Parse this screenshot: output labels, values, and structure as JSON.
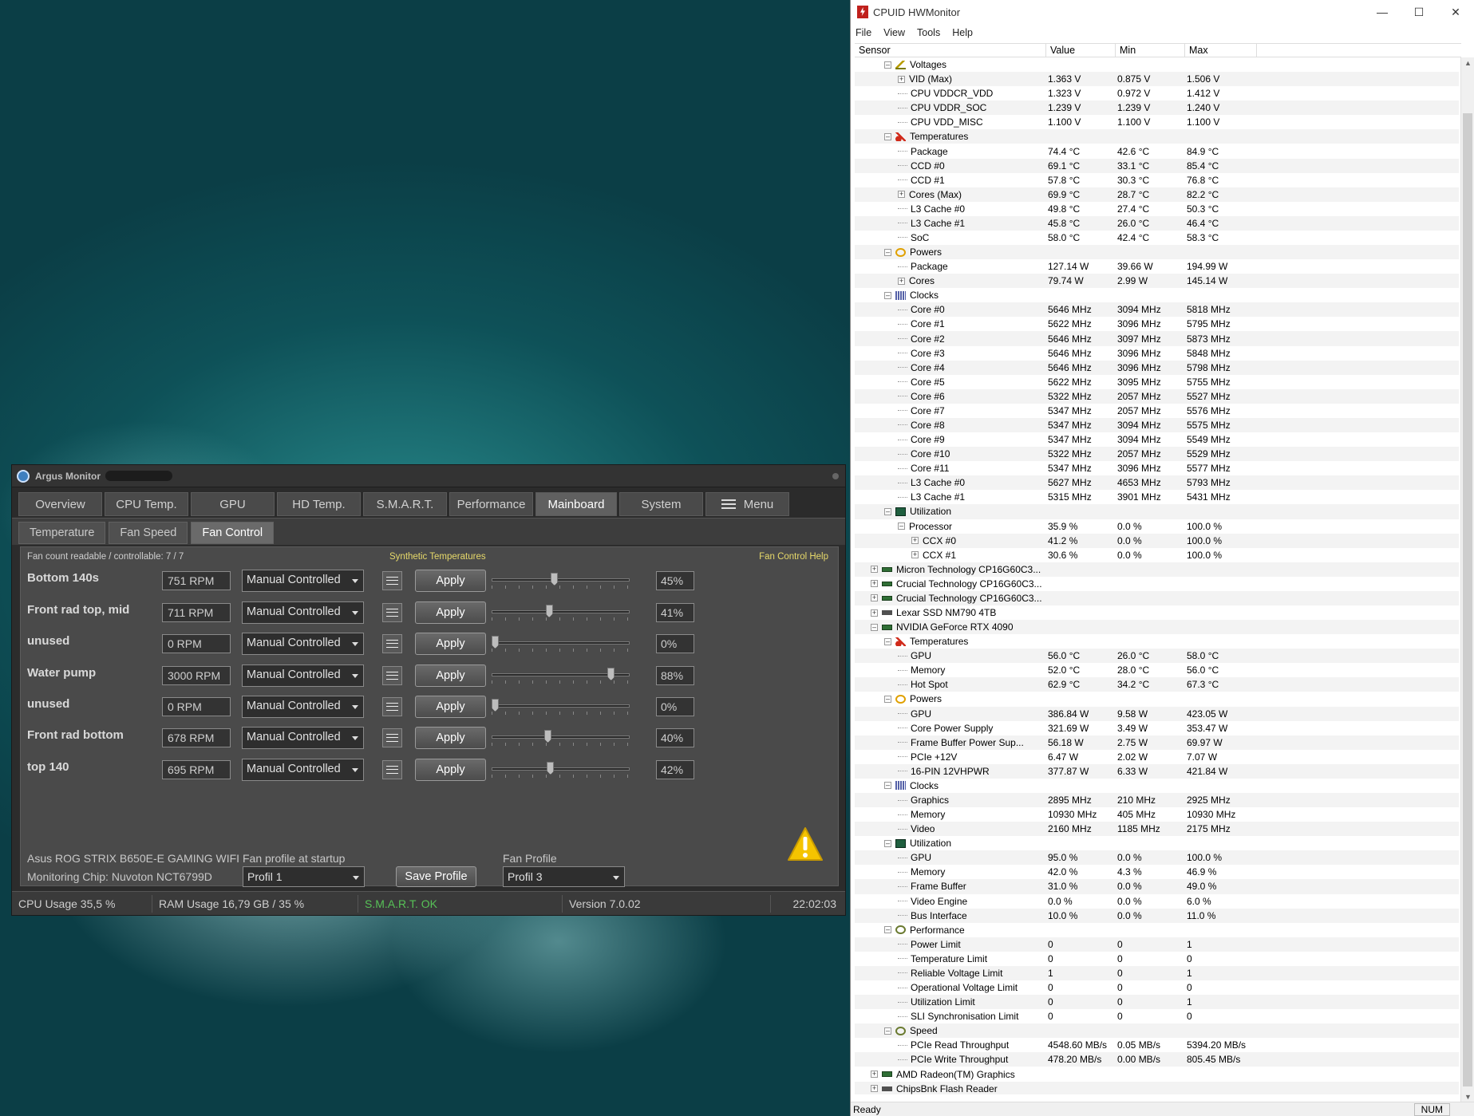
{
  "argus": {
    "title": "Argus Monitor",
    "tabs": [
      "Overview",
      "CPU Temp.",
      "GPU",
      "HD Temp.",
      "S.M.A.R.T.",
      "Performance",
      "Mainboard",
      "System"
    ],
    "menu_label": "Menu",
    "active_tab": "Mainboard",
    "subtabs": [
      "Temperature",
      "Fan Speed",
      "Fan Control"
    ],
    "active_subtab": "Fan Control",
    "fan_count_text": "Fan count readable / controllable: 7 / 7",
    "synthetic_link": "Synthetic Temperatures",
    "help_link": "Fan Control Help",
    "apply_label": "Apply",
    "fans": [
      {
        "name": "Bottom 140s",
        "rpm": "751 RPM",
        "mode": "Manual Controlled",
        "percent": 45,
        "percent_text": "45%"
      },
      {
        "name": "Front rad top, mid",
        "rpm": "711 RPM",
        "mode": "Manual Controlled",
        "percent": 41,
        "percent_text": "41%"
      },
      {
        "name": "unused",
        "rpm": "0 RPM",
        "mode": "Manual Controlled",
        "percent": 0,
        "percent_text": "0%"
      },
      {
        "name": "Water pump",
        "rpm": "3000 RPM",
        "mode": "Manual Controlled",
        "percent": 88,
        "percent_text": "88%"
      },
      {
        "name": "unused",
        "rpm": "0 RPM",
        "mode": "Manual Controlled",
        "percent": 0,
        "percent_text": "0%"
      },
      {
        "name": "Front rad bottom",
        "rpm": "678 RPM",
        "mode": "Manual Controlled",
        "percent": 40,
        "percent_text": "40%"
      },
      {
        "name": "top 140",
        "rpm": "695 RPM",
        "mode": "Manual Controlled",
        "percent": 42,
        "percent_text": "42%"
      }
    ],
    "board": "Asus ROG STRIX B650E-E GAMING WIFI",
    "chip": "Monitoring Chip: Nuvoton NCT6799D",
    "startup_label": "Fan profile at startup",
    "startup_value": "Profil 1",
    "save_label": "Save Profile",
    "profile_label": "Fan Profile",
    "profile_value": "Profil 3",
    "status": {
      "cpu": "CPU Usage 35,5 %",
      "ram": "RAM Usage 16,79 GB / 35 %",
      "smart": "S.M.A.R.T. OK",
      "version": "Version 7.0.02",
      "time": "22:02:03"
    },
    "colors": {
      "smart_ok": "#57c257",
      "link_yellow": "#e7d96a",
      "warn": "#f5c400"
    }
  },
  "hwm": {
    "title": "CPUID HWMonitor",
    "menu": [
      "File",
      "View",
      "Tools",
      "Help"
    ],
    "columns": [
      "Sensor",
      "Value",
      "Min",
      "Max"
    ],
    "rows": [
      {
        "d": 2,
        "t": "g",
        "icon": "volt",
        "exp": "-",
        "name": "Voltages"
      },
      {
        "d": 3,
        "exp": "+",
        "name": "VID (Max)",
        "v": "1.363 V",
        "mn": "0.875 V",
        "mx": "1.506 V"
      },
      {
        "d": 3,
        "name": "CPU VDDCR_VDD",
        "v": "1.323 V",
        "mn": "0.972 V",
        "mx": "1.412 V"
      },
      {
        "d": 3,
        "name": "CPU VDDR_SOC",
        "v": "1.239 V",
        "mn": "1.239 V",
        "mx": "1.240 V"
      },
      {
        "d": 3,
        "name": "CPU VDD_MISC",
        "v": "1.100 V",
        "mn": "1.100 V",
        "mx": "1.100 V"
      },
      {
        "d": 2,
        "t": "g",
        "icon": "temp",
        "exp": "-",
        "name": "Temperatures"
      },
      {
        "d": 3,
        "name": "Package",
        "v": "74.4 °C",
        "mn": "42.6 °C",
        "mx": "84.9 °C"
      },
      {
        "d": 3,
        "name": "CCD #0",
        "v": "69.1 °C",
        "mn": "33.1 °C",
        "mx": "85.4 °C"
      },
      {
        "d": 3,
        "name": "CCD #1",
        "v": "57.8 °C",
        "mn": "30.3 °C",
        "mx": "76.8 °C"
      },
      {
        "d": 3,
        "exp": "+",
        "name": "Cores (Max)",
        "v": "69.9 °C",
        "mn": "28.7 °C",
        "mx": "82.2 °C"
      },
      {
        "d": 3,
        "name": "L3 Cache #0",
        "v": "49.8 °C",
        "mn": "27.4 °C",
        "mx": "50.3 °C"
      },
      {
        "d": 3,
        "name": "L3 Cache #1",
        "v": "45.8 °C",
        "mn": "26.0 °C",
        "mx": "46.4 °C"
      },
      {
        "d": 3,
        "name": "SoC",
        "v": "58.0 °C",
        "mn": "42.4 °C",
        "mx": "58.3 °C"
      },
      {
        "d": 2,
        "t": "g",
        "icon": "pow",
        "exp": "-",
        "name": "Powers"
      },
      {
        "d": 3,
        "name": "Package",
        "v": "127.14 W",
        "mn": "39.66 W",
        "mx": "194.99 W"
      },
      {
        "d": 3,
        "exp": "+",
        "name": "Cores",
        "v": "79.74 W",
        "mn": "2.99 W",
        "mx": "145.14 W"
      },
      {
        "d": 2,
        "t": "g",
        "icon": "clk",
        "exp": "-",
        "name": "Clocks"
      },
      {
        "d": 3,
        "name": "Core #0",
        "v": "5646 MHz",
        "mn": "3094 MHz",
        "mx": "5818 MHz"
      },
      {
        "d": 3,
        "name": "Core #1",
        "v": "5622 MHz",
        "mn": "3096 MHz",
        "mx": "5795 MHz"
      },
      {
        "d": 3,
        "name": "Core #2",
        "v": "5646 MHz",
        "mn": "3097 MHz",
        "mx": "5873 MHz"
      },
      {
        "d": 3,
        "name": "Core #3",
        "v": "5646 MHz",
        "mn": "3096 MHz",
        "mx": "5848 MHz"
      },
      {
        "d": 3,
        "name": "Core #4",
        "v": "5646 MHz",
        "mn": "3096 MHz",
        "mx": "5798 MHz"
      },
      {
        "d": 3,
        "name": "Core #5",
        "v": "5622 MHz",
        "mn": "3095 MHz",
        "mx": "5755 MHz"
      },
      {
        "d": 3,
        "name": "Core #6",
        "v": "5322 MHz",
        "mn": "2057 MHz",
        "mx": "5527 MHz"
      },
      {
        "d": 3,
        "name": "Core #7",
        "v": "5347 MHz",
        "mn": "2057 MHz",
        "mx": "5576 MHz"
      },
      {
        "d": 3,
        "name": "Core #8",
        "v": "5347 MHz",
        "mn": "3094 MHz",
        "mx": "5575 MHz"
      },
      {
        "d": 3,
        "name": "Core #9",
        "v": "5347 MHz",
        "mn": "3094 MHz",
        "mx": "5549 MHz"
      },
      {
        "d": 3,
        "name": "Core #10",
        "v": "5322 MHz",
        "mn": "2057 MHz",
        "mx": "5529 MHz"
      },
      {
        "d": 3,
        "name": "Core #11",
        "v": "5347 MHz",
        "mn": "3096 MHz",
        "mx": "5577 MHz"
      },
      {
        "d": 3,
        "name": "L3 Cache #0",
        "v": "5627 MHz",
        "mn": "4653 MHz",
        "mx": "5793 MHz"
      },
      {
        "d": 3,
        "name": "L3 Cache #1",
        "v": "5315 MHz",
        "mn": "3901 MHz",
        "mx": "5431 MHz"
      },
      {
        "d": 2,
        "t": "g",
        "icon": "util",
        "exp": "-",
        "name": "Utilization"
      },
      {
        "d": 3,
        "exp": "-",
        "name": "Processor",
        "v": "35.9 %",
        "mn": "0.0 %",
        "mx": "100.0 %"
      },
      {
        "d": 4,
        "exp": "+",
        "name": "CCX #0",
        "v": "41.2 %",
        "mn": "0.0 %",
        "mx": "100.0 %"
      },
      {
        "d": 4,
        "exp": "+",
        "name": "CCX #1",
        "v": "30.6 %",
        "mn": "0.0 %",
        "mx": "100.0 %"
      },
      {
        "d": 1,
        "t": "g",
        "icon": "dev",
        "exp": "+",
        "name": "Micron Technology CP16G60C3..."
      },
      {
        "d": 1,
        "t": "g",
        "icon": "dev",
        "exp": "+",
        "name": "Crucial Technology CP16G60C3..."
      },
      {
        "d": 1,
        "t": "g",
        "icon": "dev",
        "exp": "+",
        "name": "Crucial Technology CP16G60C3..."
      },
      {
        "d": 1,
        "t": "g",
        "icon": "ssd",
        "exp": "+",
        "name": "Lexar SSD NM790 4TB"
      },
      {
        "d": 1,
        "t": "g",
        "icon": "gpu",
        "exp": "-",
        "name": "NVIDIA GeForce RTX 4090"
      },
      {
        "d": 2,
        "t": "g",
        "icon": "temp",
        "exp": "-",
        "name": "Temperatures"
      },
      {
        "d": 3,
        "name": "GPU",
        "v": "56.0 °C",
        "mn": "26.0 °C",
        "mx": "58.0 °C"
      },
      {
        "d": 3,
        "name": "Memory",
        "v": "52.0 °C",
        "mn": "28.0 °C",
        "mx": "56.0 °C"
      },
      {
        "d": 3,
        "name": "Hot Spot",
        "v": "62.9 °C",
        "mn": "34.2 °C",
        "mx": "67.3 °C"
      },
      {
        "d": 2,
        "t": "g",
        "icon": "pow",
        "exp": "-",
        "name": "Powers"
      },
      {
        "d": 3,
        "name": "GPU",
        "v": "386.84 W",
        "mn": "9.58 W",
        "mx": "423.05 W"
      },
      {
        "d": 3,
        "name": "Core Power Supply",
        "v": "321.69 W",
        "mn": "3.49 W",
        "mx": "353.47 W"
      },
      {
        "d": 3,
        "name": "Frame Buffer Power Sup...",
        "v": "56.18 W",
        "mn": "2.75 W",
        "mx": "69.97 W"
      },
      {
        "d": 3,
        "name": "PCIe +12V",
        "v": "6.47 W",
        "mn": "2.02 W",
        "mx": "7.07 W"
      },
      {
        "d": 3,
        "name": "16-PIN 12VHPWR",
        "v": "377.87 W",
        "mn": "6.33 W",
        "mx": "421.84 W"
      },
      {
        "d": 2,
        "t": "g",
        "icon": "clk",
        "exp": "-",
        "name": "Clocks"
      },
      {
        "d": 3,
        "name": "Graphics",
        "v": "2895 MHz",
        "mn": "210 MHz",
        "mx": "2925 MHz"
      },
      {
        "d": 3,
        "name": "Memory",
        "v": "10930 MHz",
        "mn": "405 MHz",
        "mx": "10930 MHz"
      },
      {
        "d": 3,
        "name": "Video",
        "v": "2160 MHz",
        "mn": "1185 MHz",
        "mx": "2175 MHz"
      },
      {
        "d": 2,
        "t": "g",
        "icon": "util",
        "exp": "-",
        "name": "Utilization"
      },
      {
        "d": 3,
        "name": "GPU",
        "v": "95.0 %",
        "mn": "0.0 %",
        "mx": "100.0 %"
      },
      {
        "d": 3,
        "name": "Memory",
        "v": "42.0 %",
        "mn": "4.3 %",
        "mx": "46.9 %"
      },
      {
        "d": 3,
        "name": "Frame Buffer",
        "v": "31.0 %",
        "mn": "0.0 %",
        "mx": "49.0 %"
      },
      {
        "d": 3,
        "name": "Video Engine",
        "v": "0.0 %",
        "mn": "0.0 %",
        "mx": "6.0 %"
      },
      {
        "d": 3,
        "name": "Bus Interface",
        "v": "10.0 %",
        "mn": "0.0 %",
        "mx": "11.0 %"
      },
      {
        "d": 2,
        "t": "g",
        "icon": "perf",
        "exp": "-",
        "name": "Performance"
      },
      {
        "d": 3,
        "name": "Power Limit",
        "v": "0",
        "mn": "0",
        "mx": "1"
      },
      {
        "d": 3,
        "name": "Temperature Limit",
        "v": "0",
        "mn": "0",
        "mx": "0"
      },
      {
        "d": 3,
        "name": "Reliable Voltage Limit",
        "v": "1",
        "mn": "0",
        "mx": "1"
      },
      {
        "d": 3,
        "name": "Operational Voltage Limit",
        "v": "0",
        "mn": "0",
        "mx": "0"
      },
      {
        "d": 3,
        "name": "Utilization Limit",
        "v": "0",
        "mn": "0",
        "mx": "1"
      },
      {
        "d": 3,
        "name": "SLI Synchronisation Limit",
        "v": "0",
        "mn": "0",
        "mx": "0"
      },
      {
        "d": 2,
        "t": "g",
        "icon": "perf",
        "exp": "-",
        "name": "Speed"
      },
      {
        "d": 3,
        "name": "PCIe Read Throughput",
        "v": "4548.60 MB/s",
        "mn": "0.05 MB/s",
        "mx": "5394.20 MB/s"
      },
      {
        "d": 3,
        "name": "PCIe Write Throughput",
        "v": "478.20 MB/s",
        "mn": "0.00 MB/s",
        "mx": "805.45 MB/s"
      },
      {
        "d": 1,
        "t": "g",
        "icon": "gpu",
        "exp": "+",
        "name": "AMD Radeon(TM) Graphics"
      },
      {
        "d": 1,
        "t": "g",
        "icon": "ssd",
        "exp": "+",
        "name": "ChipsBnk Flash Reader"
      }
    ],
    "status_text": "Ready",
    "num_label": "NUM"
  }
}
